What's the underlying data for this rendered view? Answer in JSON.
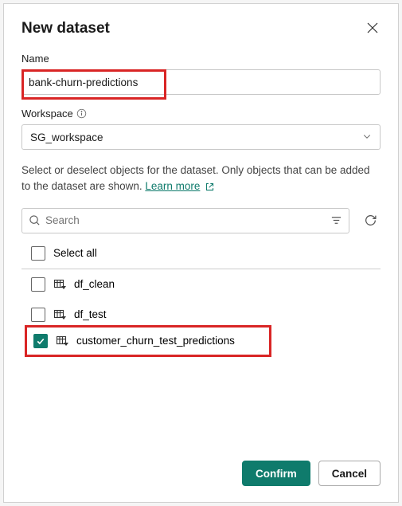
{
  "dialog": {
    "title": "New dataset",
    "name_label": "Name",
    "name_value": "bank-churn-predictions",
    "workspace_label": "Workspace",
    "workspace_value": "SG_workspace",
    "info_text": "Select or deselect objects for the dataset. Only objects that can be added to the dataset are shown. ",
    "learn_more": "Learn more ",
    "search_placeholder": "Search",
    "select_all": "Select all",
    "items": [
      {
        "label": "df_clean",
        "checked": false
      },
      {
        "label": "df_test",
        "checked": false
      },
      {
        "label": "customer_churn_test_predictions",
        "checked": true
      }
    ],
    "confirm": "Confirm",
    "cancel": "Cancel"
  }
}
